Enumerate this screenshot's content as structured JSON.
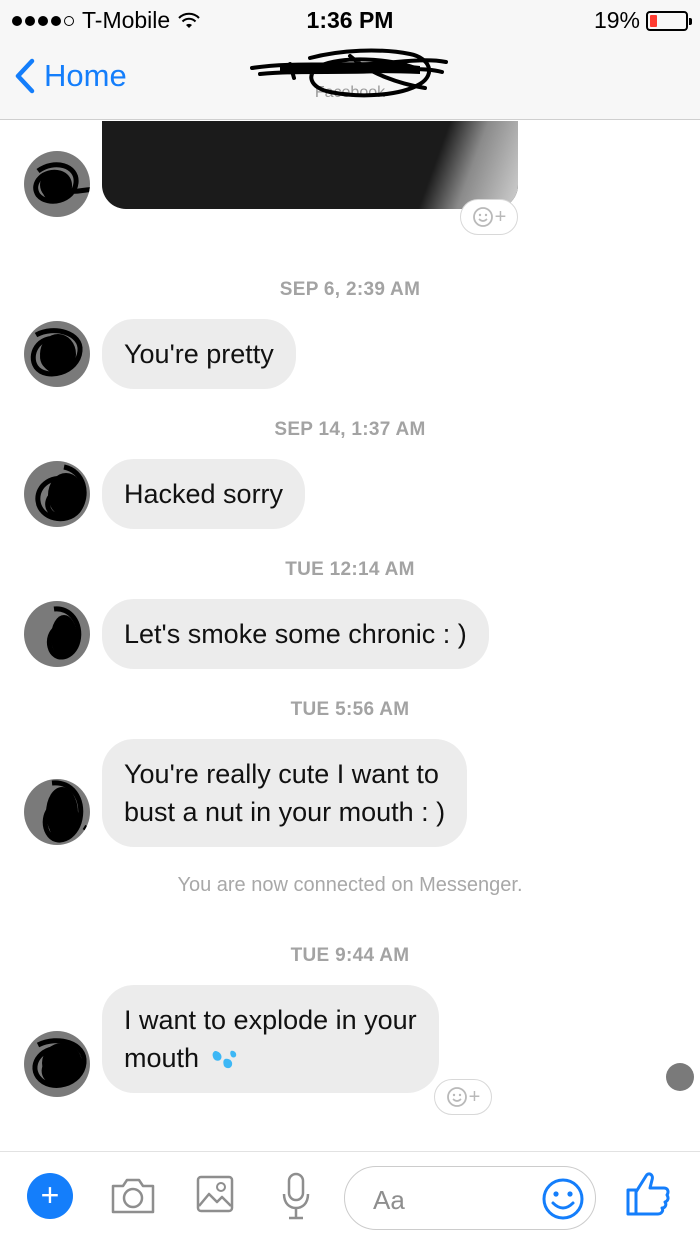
{
  "status_bar": {
    "carrier": "T-Mobile",
    "time": "1:36 PM",
    "battery_percent": "19%",
    "battery_level": 0.19,
    "signal_bars": 4,
    "low_battery_color": "#ff3b30"
  },
  "nav": {
    "back_label": "Home",
    "subtitle": "Facebook",
    "accent_color": "#147efb"
  },
  "messages": [
    {
      "kind": "timestamp",
      "text": "SEP 6, 2:39 AM"
    },
    {
      "kind": "incoming",
      "text": "You're pretty"
    },
    {
      "kind": "timestamp",
      "text": "SEP 14, 1:37 AM"
    },
    {
      "kind": "incoming",
      "text": "Hacked sorry"
    },
    {
      "kind": "timestamp",
      "text": "TUE 12:14 AM"
    },
    {
      "kind": "incoming",
      "text": "Let's smoke some chronic : )"
    },
    {
      "kind": "timestamp",
      "text": "TUE 5:56 AM"
    },
    {
      "kind": "incoming",
      "lines": [
        "You're really cute I want to",
        "bust a nut in your mouth : )"
      ]
    },
    {
      "kind": "system",
      "text": "You are now connected on Messenger."
    },
    {
      "kind": "timestamp",
      "text": "TUE 9:44 AM"
    },
    {
      "kind": "incoming",
      "lines": [
        "I want to explode in your",
        "mouth"
      ],
      "trailing_emoji": "sweat-droplets"
    }
  ],
  "composer": {
    "placeholder": "Aa",
    "icons": [
      "plus-icon",
      "camera-icon",
      "gallery-icon",
      "microphone-icon",
      "emoji-icon",
      "thumbs-up-icon"
    ]
  }
}
